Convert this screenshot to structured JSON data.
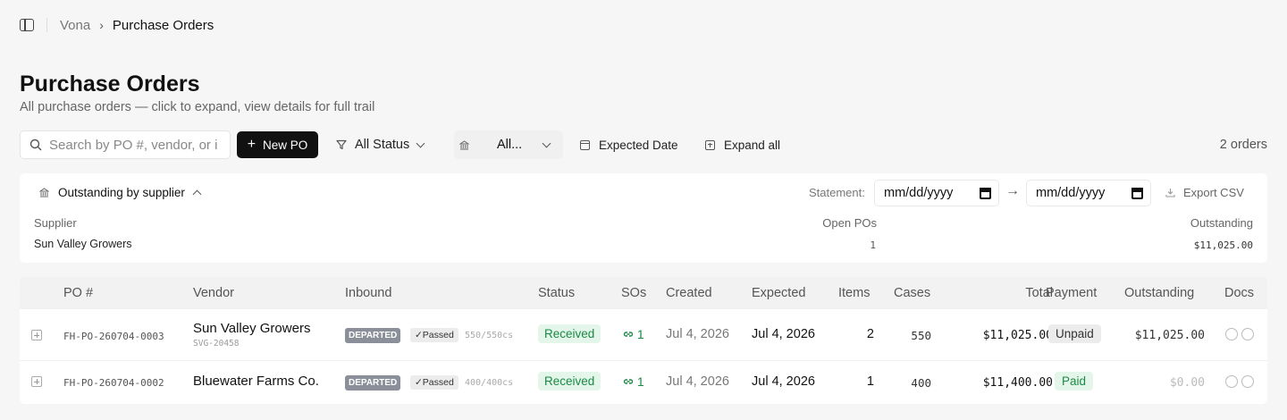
{
  "breadcrumb": {
    "root": "Vona",
    "separator": "›",
    "current": "Purchase Orders"
  },
  "page": {
    "title": "Purchase Orders",
    "subtitle": "All purchase orders — click to expand, view details for full trail"
  },
  "toolbar": {
    "search_placeholder": "Search by PO #, vendor, or i",
    "new_po": "New PO",
    "status_filter": "All Status",
    "vendor_filter": "All...",
    "date_filter": "Expected Date",
    "expand_all": "Expand all",
    "orders_count": "2 orders"
  },
  "outstanding": {
    "title": "Outstanding by supplier",
    "statement_label": "Statement:",
    "date_from": "mm/dd/yyyy",
    "date_to": "mm/dd/yyyy",
    "arrow": "→",
    "export": "Export CSV",
    "headers": {
      "supplier": "Supplier",
      "open_pos": "Open POs",
      "outstanding": "Outstanding"
    },
    "rows": [
      {
        "supplier": "Sun Valley Growers",
        "open_pos": "1",
        "outstanding": "$11,025.00"
      }
    ]
  },
  "table": {
    "headers": {
      "po": "PO #",
      "vendor": "Vendor",
      "inbound": "Inbound",
      "status": "Status",
      "sos": "SOs",
      "created": "Created",
      "expected": "Expected",
      "items": "Items",
      "cases": "Cases",
      "total": "Total",
      "payment": "Payment",
      "outstanding": "Outstanding",
      "docs": "Docs"
    },
    "rows": [
      {
        "po": "FH-PO-260704-0003",
        "vendor": "Sun Valley Growers",
        "vendor_code": "SVG-20458",
        "inbound_state": "DEPARTED",
        "inspection": "✓Passed",
        "inbound_cases": "550/550cs",
        "status": "Received",
        "sos": "1",
        "created": "Jul 4, 2026",
        "expected": "Jul 4, 2026",
        "items": "2",
        "cases": "550",
        "total": "$11,025.00",
        "payment": "Unpaid",
        "outstanding": "$11,025.00"
      },
      {
        "po": "FH-PO-260704-0002",
        "vendor": "Bluewater Farms Co.",
        "vendor_code": "",
        "inbound_state": "DEPARTED",
        "inspection": "✓Passed",
        "inbound_cases": "400/400cs",
        "status": "Received",
        "sos": "1",
        "created": "Jul 4, 2026",
        "expected": "Jul 4, 2026",
        "items": "1",
        "cases": "400",
        "total": "$11,400.00",
        "payment": "Paid",
        "outstanding": "$0.00"
      }
    ]
  },
  "colors": {
    "accent_green": "#1b8a45",
    "primary_button": "#111111",
    "badge_departed": "#8a8f99"
  }
}
